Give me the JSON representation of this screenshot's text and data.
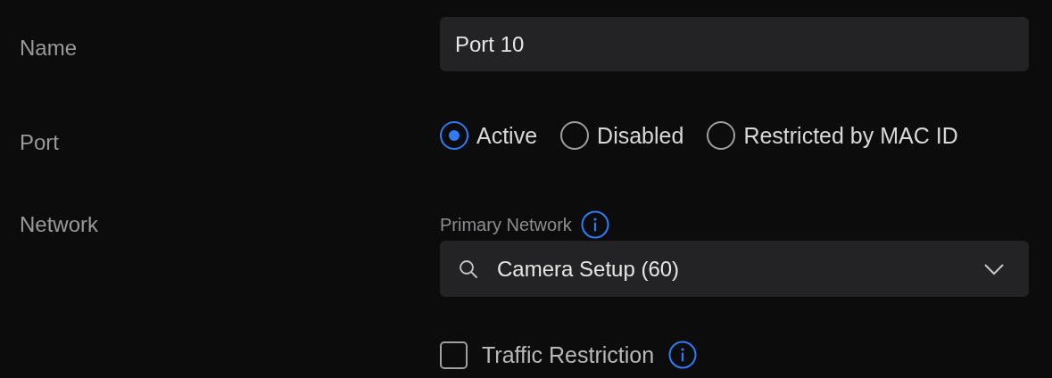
{
  "name": {
    "label": "Name",
    "value": "Port 10"
  },
  "port": {
    "label": "Port",
    "options": [
      {
        "label": "Active",
        "selected": true
      },
      {
        "label": "Disabled",
        "selected": false
      },
      {
        "label": "Restricted by MAC ID",
        "selected": false
      }
    ]
  },
  "network": {
    "label": "Network",
    "primary_label": "Primary Network",
    "value": "Camera Setup (60)"
  },
  "traffic_restriction": {
    "label": "Traffic Restriction",
    "checked": false
  }
}
